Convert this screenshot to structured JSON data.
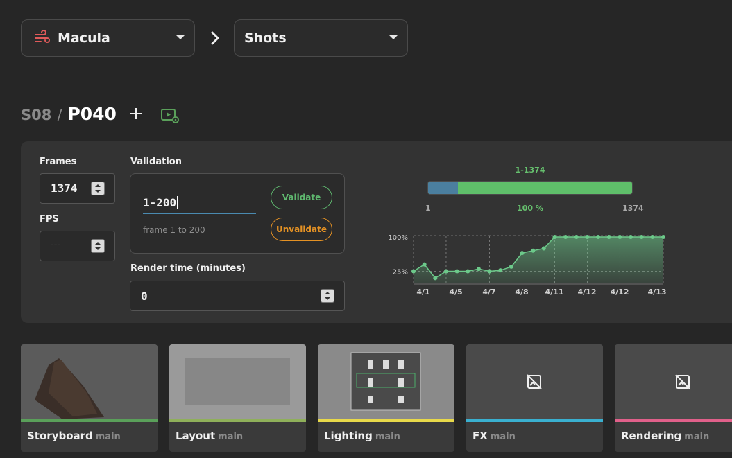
{
  "header": {
    "project": {
      "label": "Macula",
      "icon": "wind-icon",
      "icon_color": "#e05a5a"
    },
    "section": {
      "label": "Shots"
    }
  },
  "breadcrumb": {
    "sequence": "S08",
    "separator": "/",
    "shot": "P040"
  },
  "frames": {
    "label": "Frames",
    "value": "1374"
  },
  "fps": {
    "label": "FPS",
    "placeholder": "---"
  },
  "validation": {
    "label": "Validation",
    "input_value": "1-200",
    "hint": "frame 1 to 200",
    "validate_label": "Validate",
    "unvalidate_label": "Unvalidate"
  },
  "render_time": {
    "label": "Render time (minutes)",
    "value": "0"
  },
  "range": {
    "label": "1-1374",
    "min": "1",
    "max": "1374",
    "percent": "100 %",
    "validated_fraction": 0.146,
    "colors": {
      "validated": "#4b7f9f",
      "remaining": "#5fbf6a"
    }
  },
  "chart_data": {
    "type": "area",
    "x_ticks": [
      "4/1",
      "4/5",
      "4/7",
      "4/8",
      "4/11",
      "4/12",
      "4/12",
      "4/13"
    ],
    "y_ticks": [
      "100%",
      "25%"
    ],
    "values": [
      25,
      40,
      10,
      25,
      25,
      25,
      30,
      25,
      27,
      35,
      65,
      70,
      75,
      100,
      100,
      100,
      100,
      100,
      100,
      100,
      100,
      100,
      100,
      100
    ],
    "ylim": [
      0,
      100
    ],
    "color": "#6cc98a",
    "grid": true
  },
  "tasks": [
    {
      "name": "Storyboard",
      "branch": "main",
      "stripe": "#5aa05a"
    },
    {
      "name": "Layout",
      "branch": "main",
      "stripe": "#8fb05a"
    },
    {
      "name": "Lighting",
      "branch": "main",
      "stripe": "#e8d94a"
    },
    {
      "name": "FX",
      "branch": "main",
      "stripe": "#3ab0d0"
    },
    {
      "name": "Rendering",
      "branch": "main",
      "stripe": "#e0608a"
    }
  ]
}
